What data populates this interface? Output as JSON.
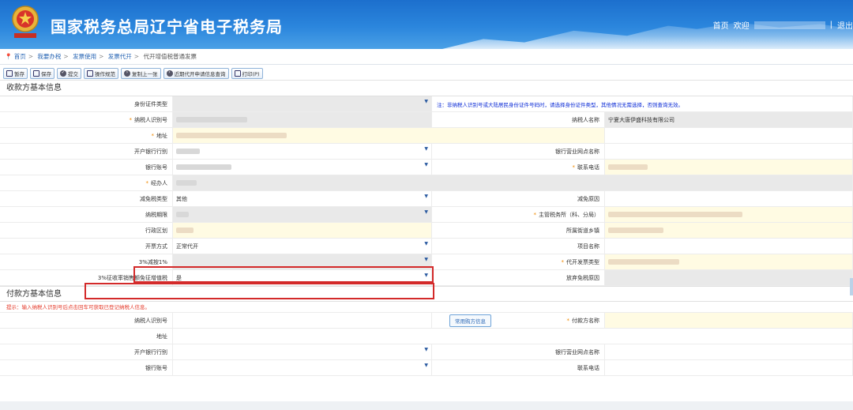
{
  "header": {
    "title": "国家税务总局辽宁省电子税务局",
    "links": [
      "首页",
      "欢迎",
      "|",
      "退出"
    ]
  },
  "breadcrumb": [
    "首页",
    "我要办税",
    "发票使用",
    "发票代开",
    "代开增值税普通发票"
  ],
  "toolbar": [
    "暂存",
    "保存",
    "提交",
    "操作规范",
    "复制上一张",
    "近期代开申请信息查询",
    "打印(P)"
  ],
  "payee": {
    "title": "收款方基本信息",
    "id_type_label": "身份证件类型",
    "note": "注：非纳税人识别号或大陆居民身份证件号码时，请选择身份证件类型，其他情况无需选择，否则查询无效。",
    "taxpayer_id_label": "纳税人识别号",
    "taxpayer_name_label": "纳税人名称",
    "taxpayer_name_value": "宁夏大唐伊盛科技有限公司",
    "address_label": "地址",
    "bank_label": "开户银行行别",
    "bank_branch_label": "银行营业网点名称",
    "account_label": "银行账号",
    "phone_label": "联系电话",
    "handler_label": "经办人",
    "relief_type_label": "减免税类型",
    "relief_type_value": "其他",
    "relief_reason_label": "减免原因",
    "period_label": "纳税期限",
    "tax_office_label": "主管税务所（科、分局）",
    "region_label": "行政区划",
    "street_label": "所属街道乡镇",
    "issue_mode_label": "开票方式",
    "issue_mode_value": "正常代开",
    "project_label": "项目名称",
    "reduce_label": "3%减按1%",
    "invoice_type_label": "代开发票类型",
    "exempt_label": "3%征收率销售额免征增值税",
    "exempt_value": "是",
    "waive_label": "放弃免税原因"
  },
  "payer": {
    "title": "付款方基本信息",
    "hint": "提示：输入纳税人识别号后点击回车可获取已登记纳税人信息。",
    "taxpayer_id_label": "纳税人识别号",
    "common_btn": "常用购方信息",
    "payer_name_label": "付款方名称",
    "address_label": "地址",
    "bank_label": "开户银行行别",
    "bank_branch_label": "银行营业网点名称",
    "account_label": "银行账号",
    "phone_label": "联系电话"
  },
  "colors": {
    "header": "#2b86dd",
    "highlight": "#d32a2a",
    "required": "#f08a00",
    "note": "#0b2bd6"
  }
}
